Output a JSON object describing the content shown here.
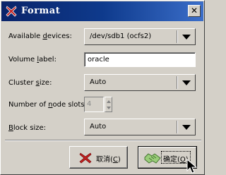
{
  "window": {
    "title": "Format",
    "icons": {
      "title": "x-icon",
      "close": "close-icon"
    },
    "close_glyph": "✕"
  },
  "form": {
    "available_devices": {
      "label_pre": "Available ",
      "label_accel": "d",
      "label_post": "evices:",
      "value": "/dev/sdb1 (ocfs2)"
    },
    "volume_label": {
      "label_pre": "Volume ",
      "label_accel": "l",
      "label_post": "abel:",
      "value": "oracle"
    },
    "cluster_size": {
      "label_pre": "Cluster ",
      "label_accel": "s",
      "label_post": "ize:",
      "value": "Auto"
    },
    "node_slots": {
      "label_pre": "Number of ",
      "label_accel": "n",
      "label_post": "ode slots:",
      "value": "4"
    },
    "block_size": {
      "label_pre": "",
      "label_accel": "B",
      "label_post": "lock size:",
      "value": "Auto"
    }
  },
  "buttons": {
    "cancel": {
      "label_pre": "取消(",
      "label_accel": "C",
      "label_post": ")",
      "icon": "cancel-x-icon"
    },
    "ok": {
      "label_pre": "确定(",
      "label_accel": "O",
      "label_post": ")",
      "icon": "ok-handshake-icon"
    }
  },
  "colors": {
    "titlebar_start": "#0a246a",
    "titlebar_end": "#3b6ec9",
    "cancel_icon": "#c02020",
    "dialog_bg": "#d4d0c8"
  }
}
